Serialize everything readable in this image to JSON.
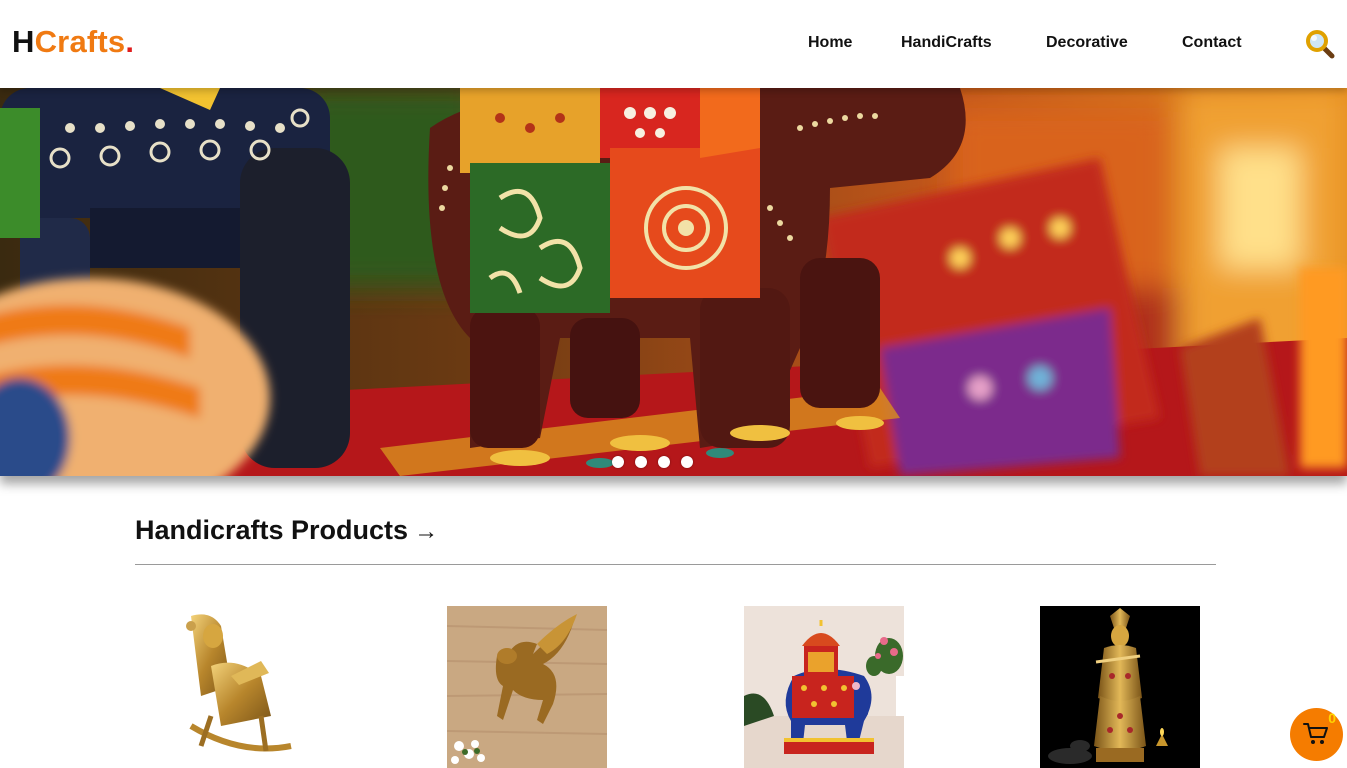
{
  "brand": {
    "first": "H",
    "rest": "Crafts",
    "dot": "."
  },
  "nav": [
    {
      "label": "Home"
    },
    {
      "label": "HandiCrafts"
    },
    {
      "label": "Decorative"
    },
    {
      "label": "Contact"
    }
  ],
  "icons": {
    "search": "search-icon",
    "arrow": "arrow-right-icon",
    "cart": "cart-icon"
  },
  "colors": {
    "accent": "#f07a12",
    "logo_dot": "#e01d1d",
    "cart_bg": "#f57c00",
    "badge": "#ffd400"
  },
  "hero": {
    "slide_count": 4
  },
  "section": {
    "title": "Handicrafts Products",
    "arrow": "→"
  },
  "products": [
    {
      "name": "brass rocking chair figurine"
    },
    {
      "name": "metal pegasus wall decor"
    },
    {
      "name": "painted elephant with howdah"
    },
    {
      "name": "brass krishna statue"
    }
  ],
  "cart": {
    "count": "0"
  }
}
